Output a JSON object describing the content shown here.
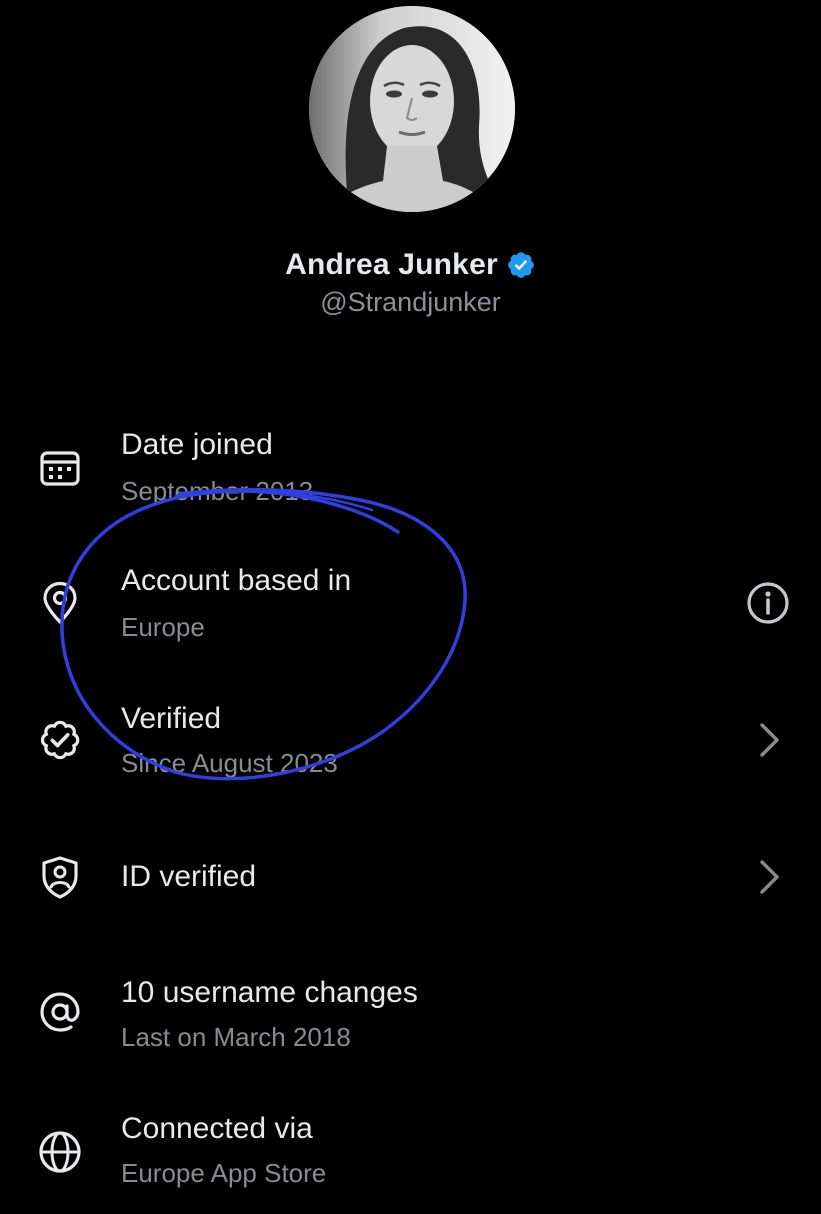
{
  "profile": {
    "display_name": "Andrea Junker",
    "handle": "@Strandjunker",
    "verified_badge_color": "#1d9bf0"
  },
  "about_items": [
    {
      "icon": "calendar-icon",
      "title": "Date joined",
      "subtitle": "September 2013",
      "trailing": ""
    },
    {
      "icon": "location-pin-icon",
      "title": "Account based in",
      "subtitle": "Europe",
      "trailing": "info-icon"
    },
    {
      "icon": "verified-check-icon",
      "title": "Verified",
      "subtitle": "Since August 2023",
      "trailing": "chevron-right-icon"
    },
    {
      "icon": "id-shield-icon",
      "title": "ID verified",
      "subtitle": "",
      "trailing": "chevron-right-icon"
    },
    {
      "icon": "at-sign-icon",
      "title": "10 username changes",
      "subtitle": "Last on March 2018",
      "trailing": ""
    },
    {
      "icon": "globe-icon",
      "title": "Connected via",
      "subtitle": "Europe App Store",
      "trailing": ""
    }
  ],
  "colors": {
    "background": "#000000",
    "primary_text": "#e7e9ea",
    "secondary_text": "#878c91",
    "annotation_stroke": "#2f3fe0"
  }
}
